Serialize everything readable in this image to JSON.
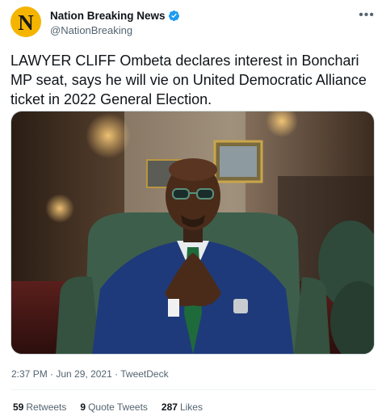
{
  "account": {
    "avatar_letter": "N",
    "display_name": "Nation Breaking News",
    "handle": "@NationBreaking",
    "verified": true,
    "brand_color": "#f4b400"
  },
  "tweet": {
    "text": "LAWYER CLIFF Ombeta declares interest in Bonchari MP seat, says he will vie on United Democratic Alliance ticket in 2022 General Election.",
    "image_icon": "photo-of-man-in-blue-suit"
  },
  "meta": {
    "time": "2:37 PM",
    "sep1": " · ",
    "date": "Jun 29, 2021",
    "sep2": " · ",
    "source": "TweetDeck"
  },
  "stats": {
    "retweets_count": "59",
    "retweets_label": "Retweets",
    "quotes_count": "9",
    "quotes_label": "Quote Tweets",
    "likes_count": "287",
    "likes_label": "Likes"
  },
  "icons": {
    "more": "more-icon",
    "verified": "verified-badge-icon"
  },
  "colors": {
    "link_blue": "#1d9bf0",
    "secondary_text": "#536471"
  }
}
